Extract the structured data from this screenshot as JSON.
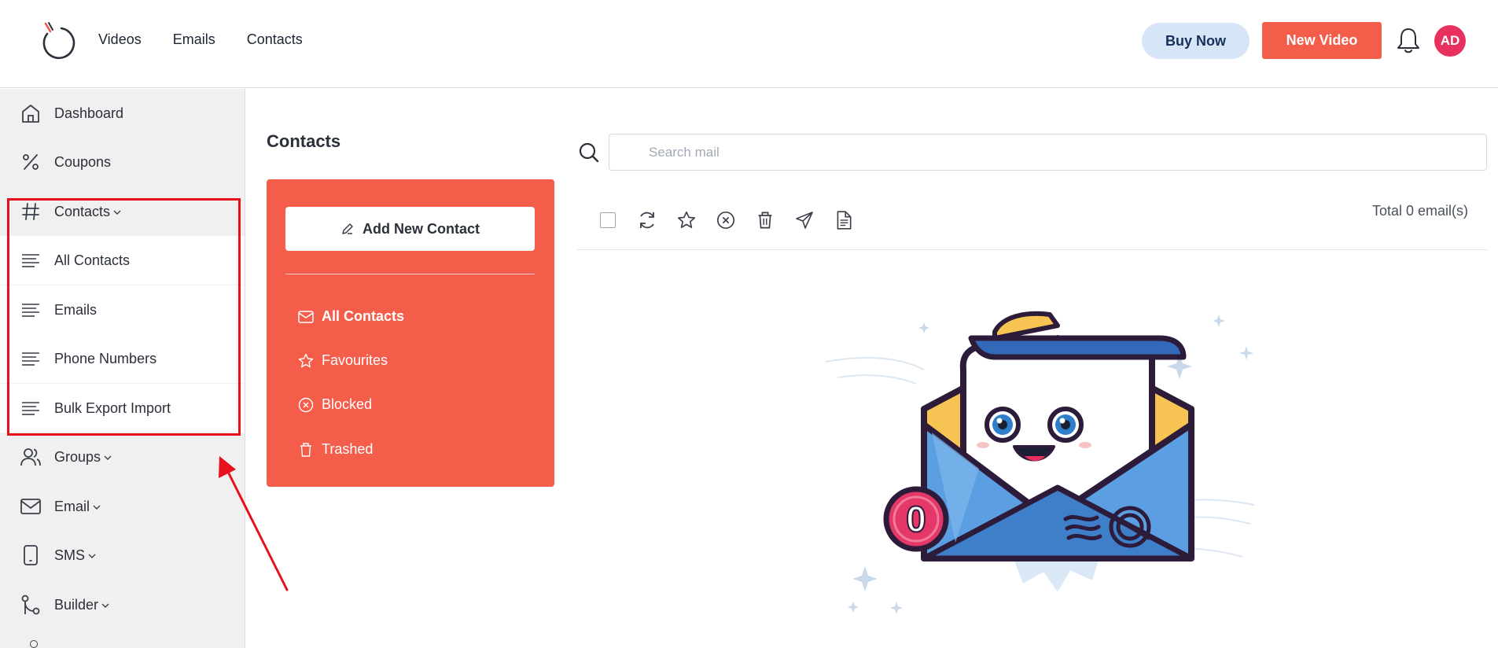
{
  "topnav": {
    "items": [
      "Videos",
      "Emails",
      "Contacts"
    ]
  },
  "header": {
    "buy_label": "Buy Now",
    "new_video_label": "New Video",
    "avatar_initials": "AD"
  },
  "sidebar": {
    "items": [
      {
        "label": "Dashboard",
        "icon": "home-icon"
      },
      {
        "label": "Coupons",
        "icon": "percent-icon"
      },
      {
        "label": "Contacts",
        "icon": "hash-icon",
        "expanded": true
      },
      {
        "label": "All Contacts",
        "icon": "lines-icon"
      },
      {
        "label": "Emails",
        "icon": "lines-icon"
      },
      {
        "label": "Phone Numbers",
        "icon": "lines-icon"
      },
      {
        "label": "Bulk Export Import",
        "icon": "lines-icon"
      },
      {
        "label": "Groups",
        "icon": "users-icon"
      },
      {
        "label": "Email",
        "icon": "mail-icon"
      },
      {
        "label": "SMS",
        "icon": "phone-icon"
      },
      {
        "label": "Builder",
        "icon": "branch-icon"
      }
    ]
  },
  "contacts_panel": {
    "title": "Contacts",
    "add_label": "Add New Contact",
    "items": [
      {
        "label": "All Contacts",
        "icon": "mail-icon",
        "active": true
      },
      {
        "label": "Favourites",
        "icon": "star-icon"
      },
      {
        "label": "Blocked",
        "icon": "x-circle-icon"
      },
      {
        "label": "Trashed",
        "icon": "trash-icon"
      }
    ]
  },
  "mail": {
    "search_placeholder": "Search mail",
    "total_text": "Total 0 email(s)",
    "badge_count": "0"
  },
  "colors": {
    "accent": "#f35d4a",
    "buy_bg": "#d6e6f6",
    "avatar": "#e8305e",
    "highlight": "#e8101b"
  }
}
